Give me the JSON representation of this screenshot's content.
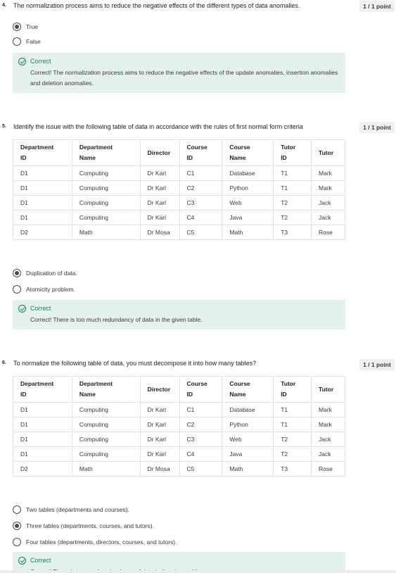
{
  "questions": [
    {
      "number": "4.",
      "text": "The normalization process aims to reduce the negative effects of the different types of data anomalies.",
      "points": "1 / 1 point",
      "options": [
        {
          "label": "True",
          "selected": true
        },
        {
          "label": "False",
          "selected": false
        }
      ],
      "feedback": {
        "title": "Correct",
        "text": "Correct! The normalization process aims to reduce the negative effects of the update anomalies, insertion anomalies and deletion anomalies."
      }
    },
    {
      "number": "5.",
      "text": "Identify the issue with the following table of data in accordance with the rules of first normal form criteria",
      "points": "1 / 1 point",
      "options": [
        {
          "label": "Duplication of data.",
          "selected": true
        },
        {
          "label": "Atomicity problem.",
          "selected": false
        }
      ],
      "feedback": {
        "title": "Correct",
        "text": "Correct! There is too much redundancy of data in the given table."
      }
    },
    {
      "number": "6.",
      "text": "To normalize the following table of data, you must decompose it into how many tables?",
      "points": "1 / 1 point",
      "options": [
        {
          "label": "Two tables (departments and courses).",
          "selected": false
        },
        {
          "label": "Three tables (departments, courses, and tutors).",
          "selected": true
        },
        {
          "label": "Four tables (departments, directors, courses, and tutors).",
          "selected": false
        }
      ],
      "feedback": {
        "title": "Correct",
        "text": "Correct! There is too much redundancy of data in the given table."
      }
    }
  ],
  "table": {
    "headers": [
      [
        "Department",
        "ID"
      ],
      [
        "Department",
        "Name"
      ],
      [
        "Director"
      ],
      [
        "Course",
        "ID"
      ],
      [
        "Course",
        "Name"
      ],
      [
        "Tutor",
        "ID"
      ],
      [
        "Tutor"
      ]
    ],
    "rows": [
      [
        "D1",
        "Computing",
        "Dr Karl",
        "C1",
        "Database",
        "T1",
        "Mark"
      ],
      [
        "D1",
        "Computing",
        "Dr Karl",
        "C2",
        "Python",
        "T1",
        "Mark"
      ],
      [
        "D1",
        "Computing",
        "Dr Karl",
        "C3",
        "Web",
        "T2",
        "Jack"
      ],
      [
        "D1",
        "Computing",
        "Dr Karl",
        "C4",
        "Java",
        "T2",
        "Jack"
      ],
      [
        "D2",
        "Math",
        "Dr Mosa",
        "C5",
        "Math",
        "T3",
        "Rose"
      ]
    ]
  },
  "colors": {
    "correct_green": "#1d7f5a",
    "feedback_bg": "#e4f1ec",
    "points_bg": "#f0f0f0"
  }
}
